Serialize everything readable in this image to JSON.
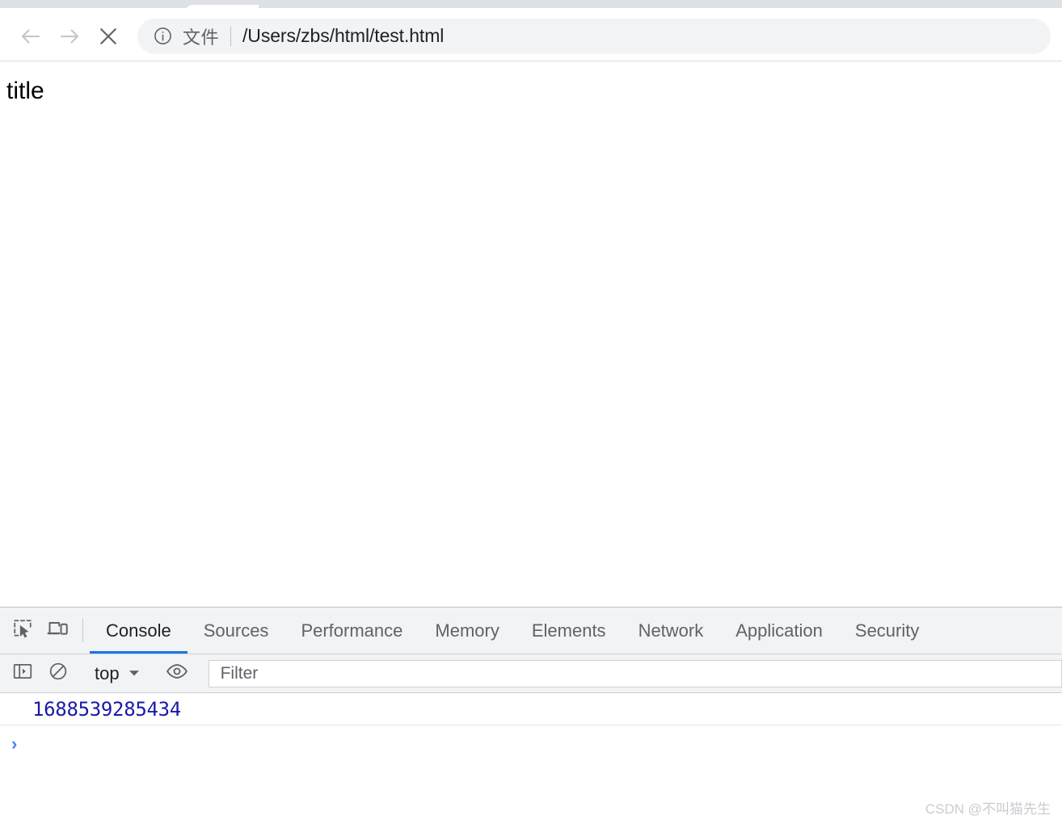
{
  "browser": {
    "nav": {
      "back_icon": "arrow-left-icon",
      "forward_icon": "arrow-right-icon",
      "stop_icon": "close-x-icon"
    },
    "omnibox": {
      "site_info_icon": "info-circle-icon",
      "scheme_label": "文件",
      "url": "/Users/zbs/html/test.html"
    }
  },
  "page": {
    "heading": "title"
  },
  "devtools": {
    "left_icons": [
      {
        "name": "inspect-element-icon",
        "title": "Inspect element"
      },
      {
        "name": "device-toolbar-icon",
        "title": "Toggle device toolbar"
      }
    ],
    "tabs": [
      {
        "label": "Console",
        "active": true
      },
      {
        "label": "Sources",
        "active": false
      },
      {
        "label": "Performance",
        "active": false
      },
      {
        "label": "Memory",
        "active": false
      },
      {
        "label": "Elements",
        "active": false
      },
      {
        "label": "Network",
        "active": false
      },
      {
        "label": "Application",
        "active": false
      },
      {
        "label": "Security",
        "active": false
      }
    ],
    "toolbar": {
      "sidebar_icon": "console-sidebar-icon",
      "clear_icon": "clear-console-icon",
      "context_value": "top",
      "context_caret_icon": "caret-down-icon",
      "eye_icon": "live-expression-eye-icon",
      "filter_placeholder": "Filter"
    },
    "console": {
      "messages": [
        {
          "text": "1688539285434",
          "color": "#1a1aa6"
        }
      ],
      "prompt_symbol": "›"
    },
    "accent_color": "#1a73e8"
  },
  "watermark": {
    "text": "CSDN @不叫猫先生"
  }
}
